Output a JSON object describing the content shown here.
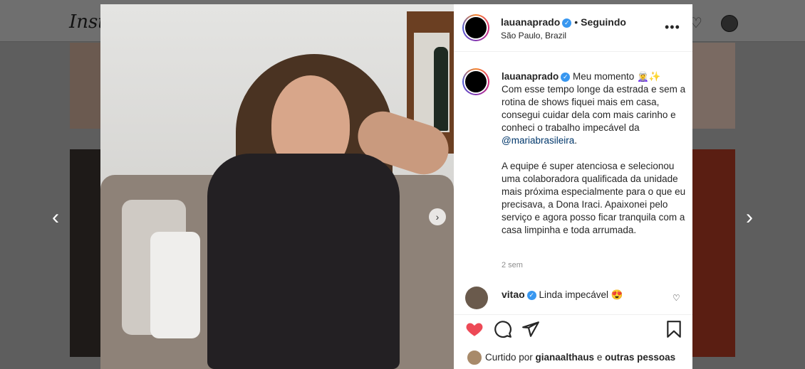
{
  "background": {
    "logo_text": "Insta",
    "heart_icon": "heart-outline-icon",
    "avatar_icon": "profile-avatar-icon"
  },
  "navigation": {
    "prev_label": "‹",
    "next_label": "›"
  },
  "photo": {
    "next_label": "›"
  },
  "post": {
    "username": "lauanaprado",
    "verified": "✓",
    "separator": "•",
    "follow_status": "Seguindo",
    "location": "São Paulo, Brazil",
    "more_label": "•••",
    "caption_username": "lauanaprado",
    "caption_line1": " Meu momento 🧝‍♀️✨",
    "caption_body": "Com esse tempo longe da estrada e sem a rotina de shows fiquei mais em casa, consegui cuidar dela com mais carinho e conheci o trabalho impecável da ",
    "caption_mention": "@mariabrasileira",
    "caption_end": ".",
    "caption_paragraph2": "A equipe é super atenciosa e selecionou uma colaboradora qualificada da unidade mais próxima especialmente para o que eu precisava, a Dona Iraci. Apaixonei pelo serviço e agora posso ficar tranquila com a casa limpinha e toda arrumada.",
    "time_ago": "2 sem",
    "comment_username": "vitao",
    "comment_text": " Linda impecável 😍",
    "comment_heart": "♡",
    "liked_prefix": "Curtido por ",
    "liked_user": "gianaalthaus",
    "liked_suffix": " e ",
    "liked_others": "outras pessoas"
  },
  "colors": {
    "like_red": "#ed4956",
    "verified_blue": "#3897f0",
    "mention_blue": "#00376b",
    "text": "#262626",
    "muted": "#8e8e8e"
  }
}
